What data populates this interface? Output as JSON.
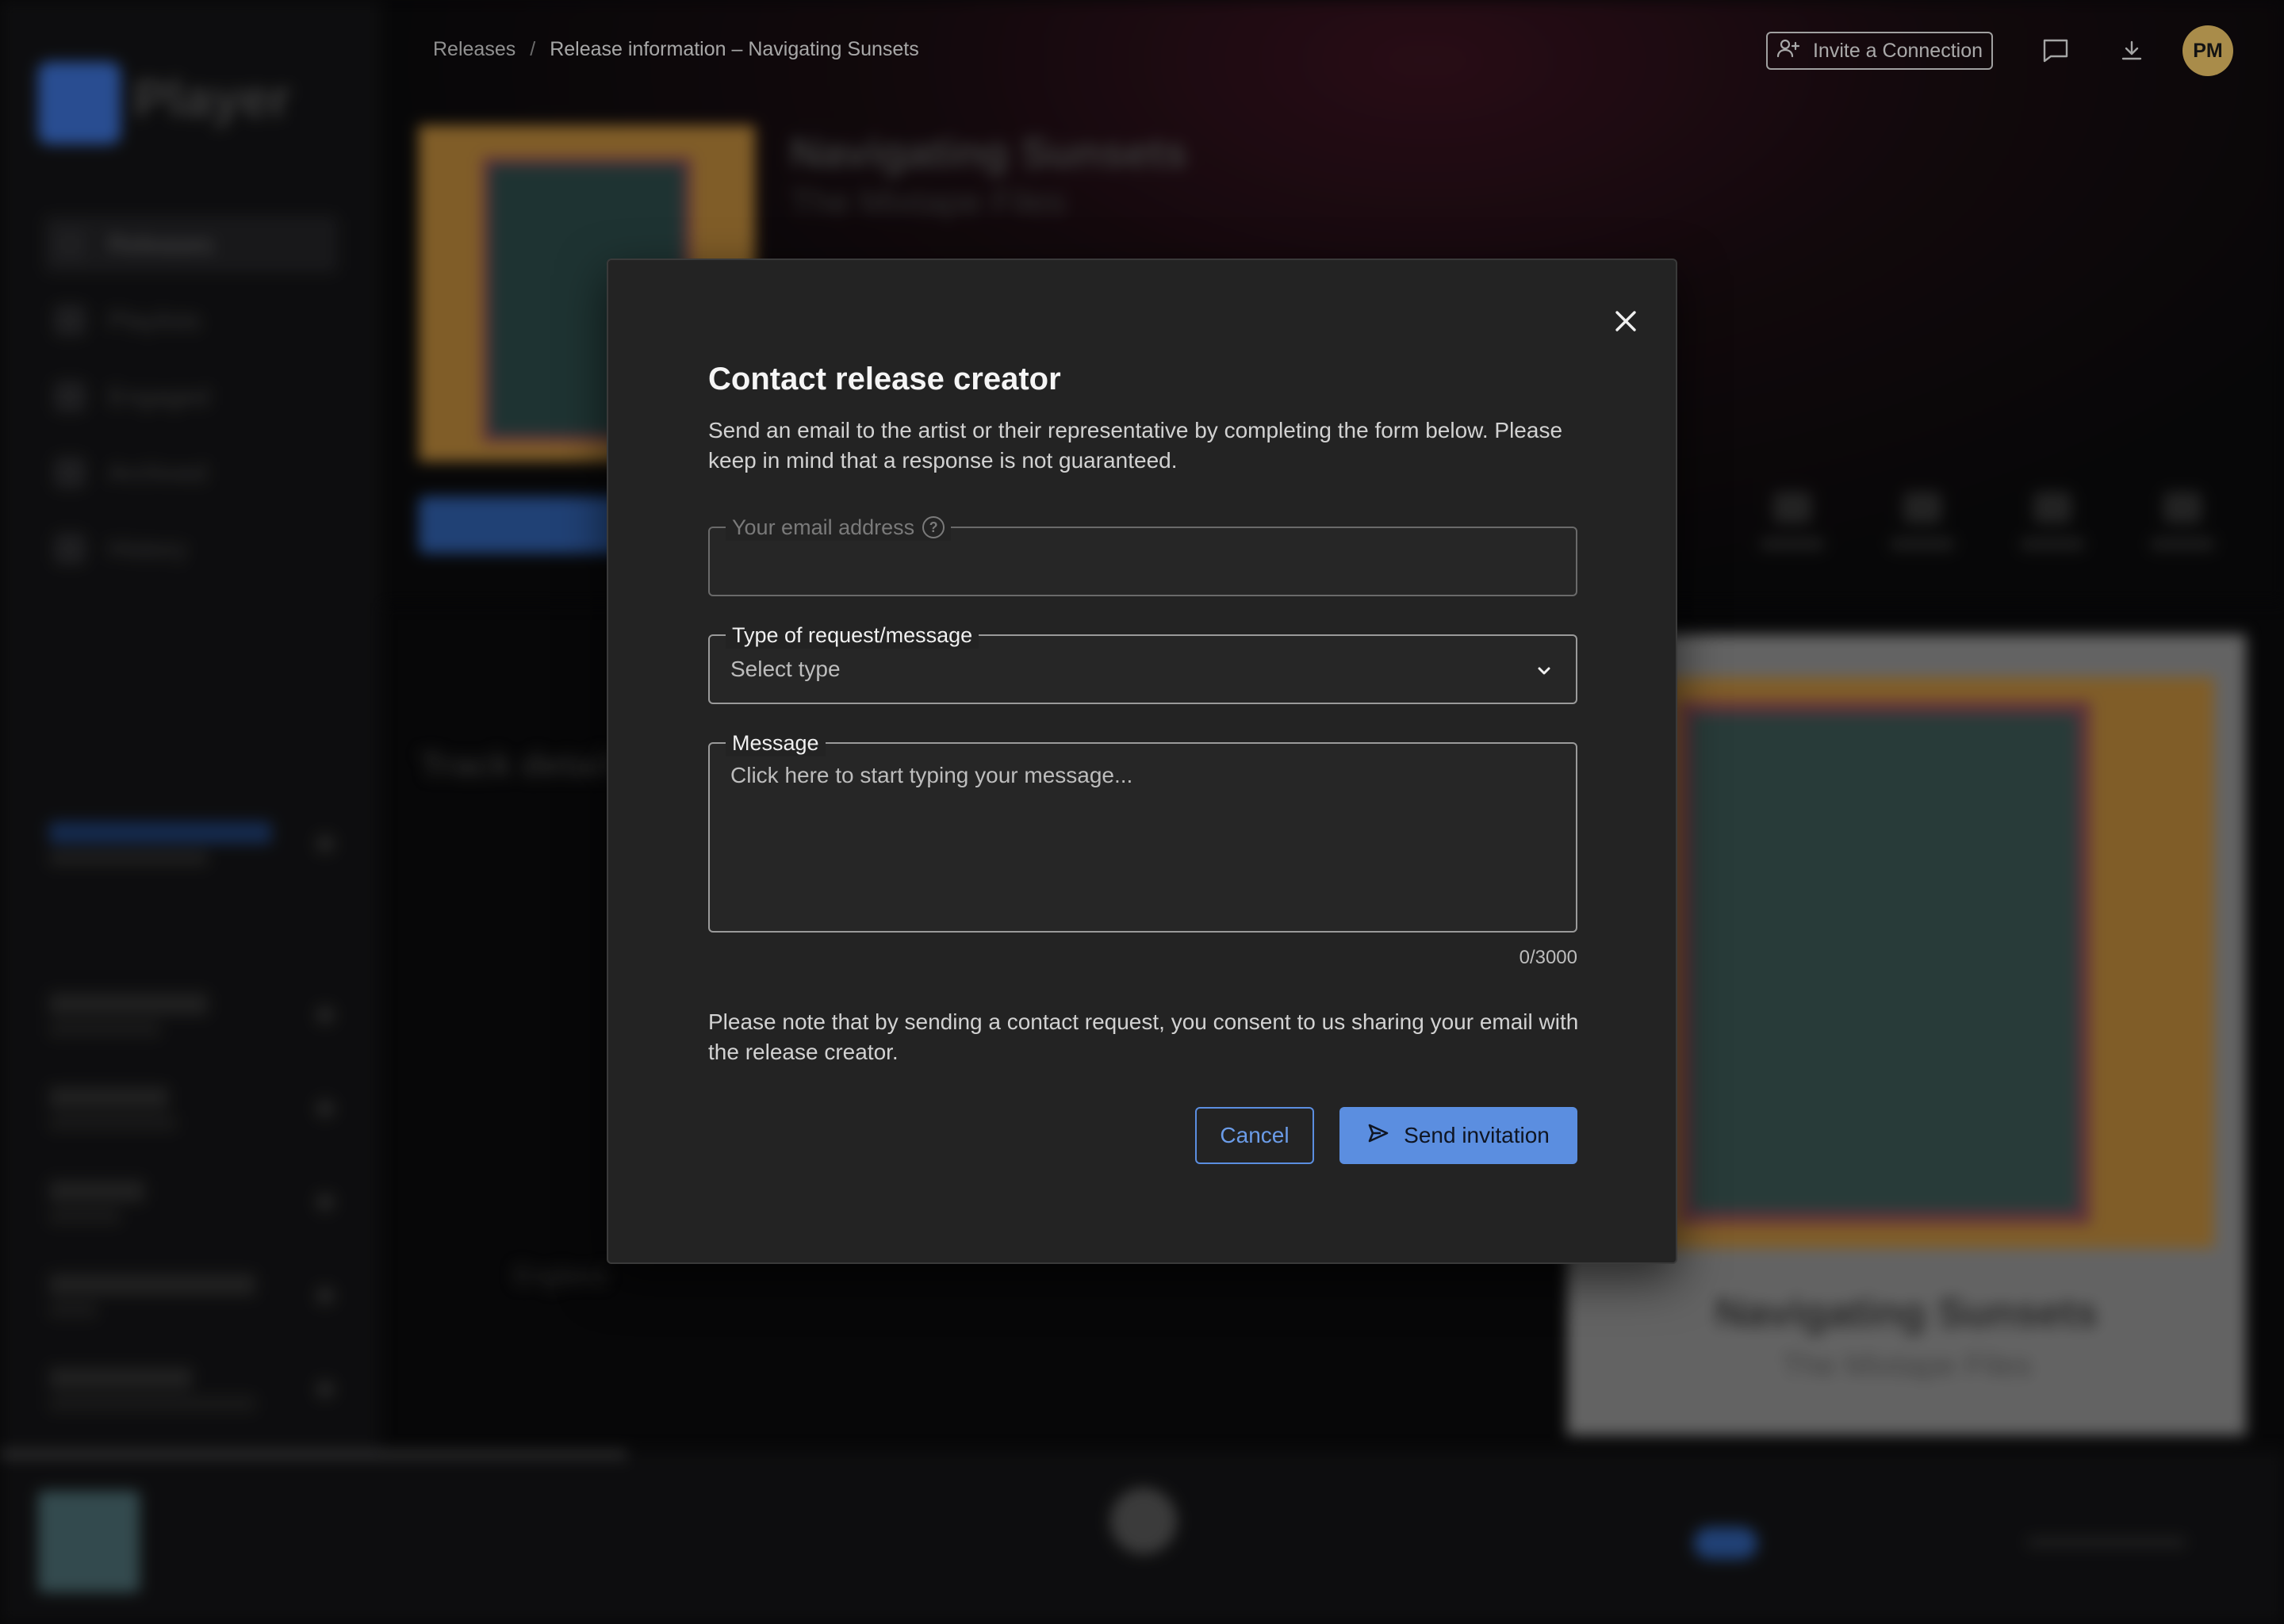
{
  "background": {
    "logo_text": "Player",
    "nav_items": [
      "Releases",
      "Playlists",
      "Engaged",
      "Archived",
      "History"
    ],
    "release_title": "Navigating Sunsets",
    "release_artist": "The Mixtape Files",
    "side_card_title": "Navigating Sunsets",
    "side_card_artist": "The Mixtape Files",
    "details_heading": "Track details",
    "detail_value": "England"
  },
  "topbar": {
    "breadcrumb_root": "Releases",
    "breadcrumb_separator": "/",
    "breadcrumb_current": "Release information – Navigating Sunsets",
    "invite_label": "Invite a Connection",
    "avatar_initials": "PM",
    "icons": [
      "person-add-icon",
      "chat-icon",
      "download-icon"
    ]
  },
  "modal": {
    "title": "Contact release creator",
    "description": "Send an email to the artist or their representative by completing the form below. Please keep in mind that a response is not guaranteed.",
    "email": {
      "label": "Your email address",
      "value": "",
      "help_glyph": "?"
    },
    "request_type": {
      "label": "Type of request/message",
      "selected": "Select type"
    },
    "message": {
      "label": "Message",
      "placeholder": "Click here to start typing your message...",
      "value": "",
      "counter": "0/3000"
    },
    "consent_note": "Please note that by sending a contact request, you consent to us sharing your email with the release creator.",
    "cancel_label": "Cancel",
    "send_label": "Send invitation"
  },
  "colors": {
    "accent": "#5b8ee0",
    "avatar": "#f2c96b",
    "modal_bg": "#232323"
  }
}
